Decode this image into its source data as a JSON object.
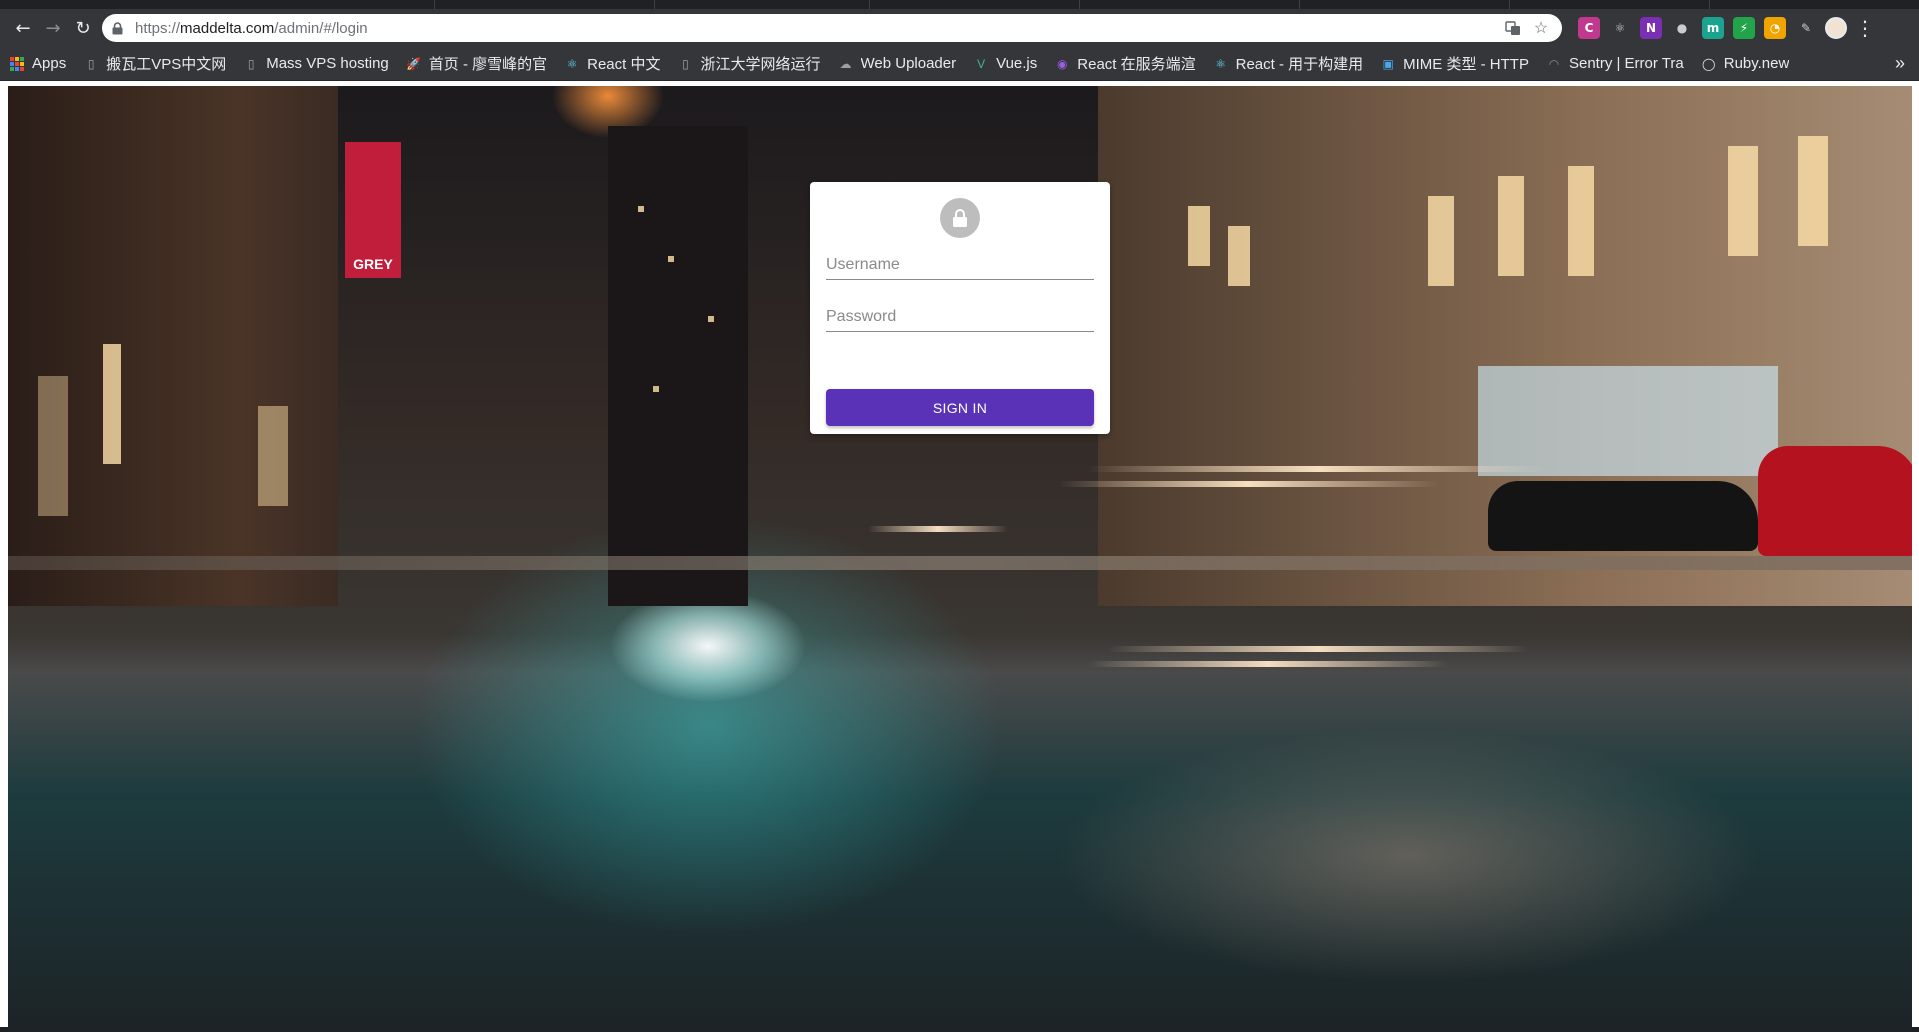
{
  "browser": {
    "url_scheme": "https://",
    "url_host": "maddelta.com",
    "url_path": "/admin/#/login"
  },
  "bookmarks": [
    {
      "label": "Apps",
      "icon": "apps-grid-icon"
    },
    {
      "label": "搬瓦工VPS中文网",
      "icon": "page-icon"
    },
    {
      "label": "Mass VPS hosting",
      "icon": "page-icon"
    },
    {
      "label": "首页 - 廖雪峰的官",
      "icon": "rocket-icon"
    },
    {
      "label": "React 中文",
      "icon": "react-icon"
    },
    {
      "label": "浙江大学网络运行",
      "icon": "page-icon"
    },
    {
      "label": "Web Uploader",
      "icon": "cloud-icon"
    },
    {
      "label": "Vue.js",
      "icon": "vue-icon"
    },
    {
      "label": "React 在服务端渲",
      "icon": "circle-icon"
    },
    {
      "label": "React - 用于构建用",
      "icon": "react-icon"
    },
    {
      "label": "MIME 类型 - HTTP",
      "icon": "mdn-icon"
    },
    {
      "label": "Sentry | Error Tra",
      "icon": "sentry-icon"
    },
    {
      "label": "Ruby.new",
      "icon": "github-icon"
    }
  ],
  "extensions": [
    {
      "name": "c-extension-icon",
      "glyph": "C",
      "color": "#c0398f"
    },
    {
      "name": "react-devtools-icon",
      "glyph": "⚛",
      "color": "#35363a"
    },
    {
      "name": "onenote-icon",
      "glyph": "N",
      "color": "#7b2fb5"
    },
    {
      "name": "gray-circle-icon",
      "glyph": "●",
      "color": "#35363a"
    },
    {
      "name": "m-extension-icon",
      "glyph": "m",
      "color": "#1aa38f"
    },
    {
      "name": "bolt-extension-icon",
      "glyph": "⚡",
      "color": "#23a34a"
    },
    {
      "name": "rss-extension-icon",
      "glyph": "◔",
      "color": "#f0a400"
    },
    {
      "name": "brush-extension-icon",
      "glyph": "✎",
      "color": "#35363a"
    }
  ],
  "photo": {
    "banner_text": "GREY"
  },
  "login": {
    "username_placeholder": "Username",
    "password_placeholder": "Password",
    "submit_label": "SIGN IN",
    "accent_color": "#5a32b8"
  }
}
